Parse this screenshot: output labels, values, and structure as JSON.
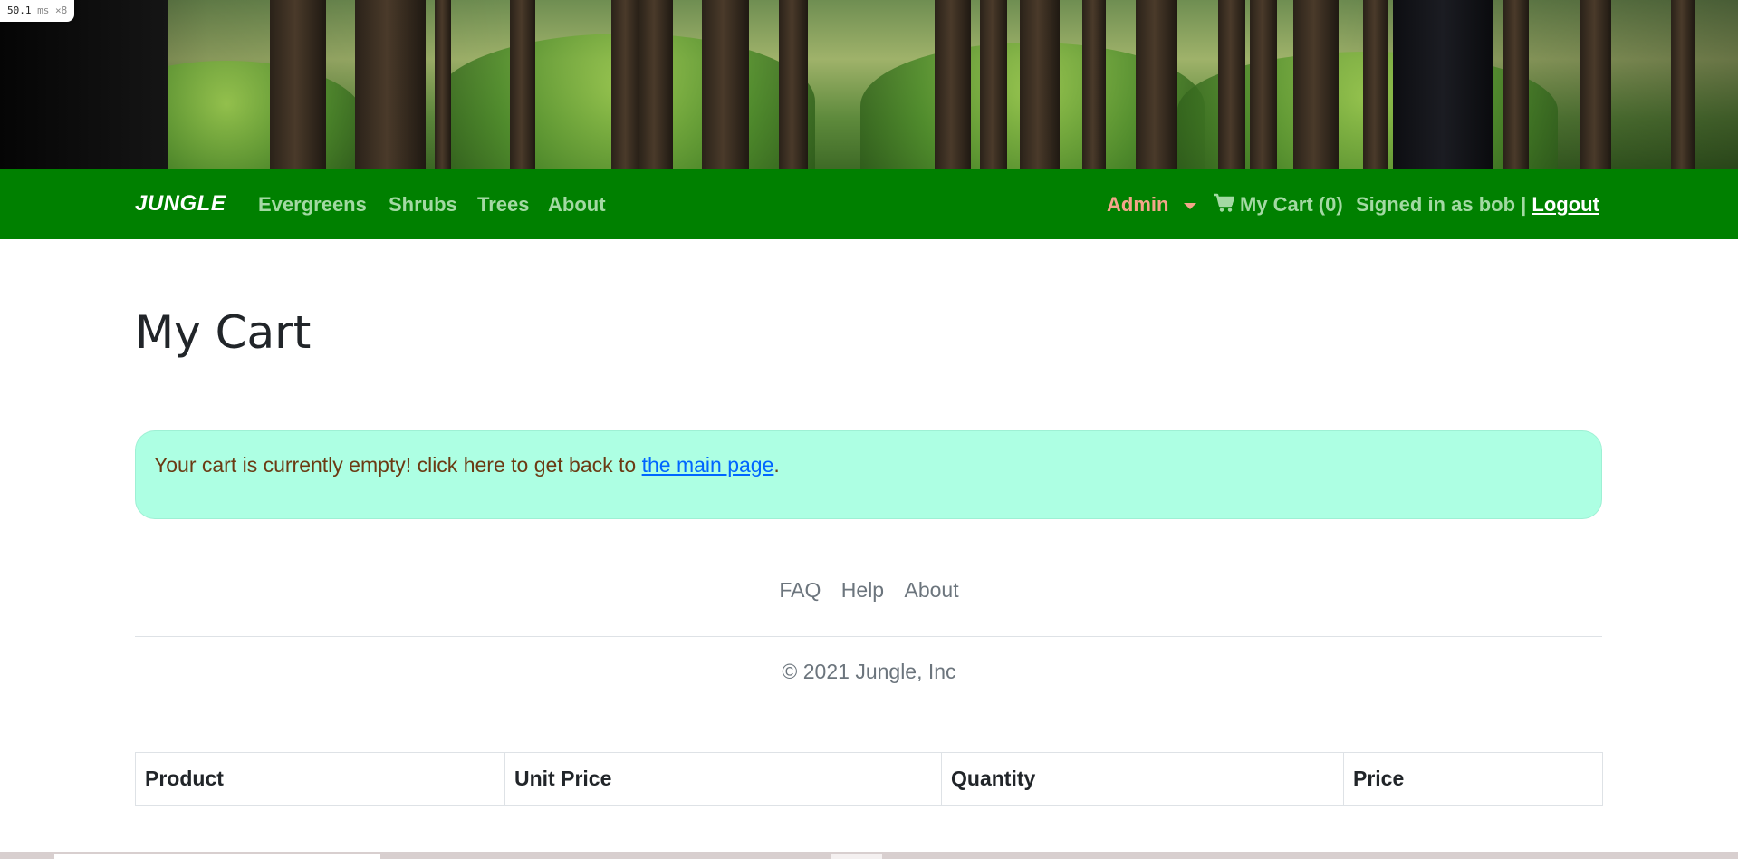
{
  "perf_badge": {
    "value": "50.1",
    "unit": "ms ×8"
  },
  "navbar": {
    "brand": "JUNGLE",
    "links": [
      "Evergreens",
      "Shrubs",
      "Trees",
      "About"
    ],
    "admin_label": "Admin",
    "cart_label": "My Cart (0)",
    "signed_in_text": "Signed in as bob |",
    "logout_label": "Logout",
    "colors": {
      "background": "#008000",
      "link": "#a3d9a3",
      "admin": "#f4a58a"
    }
  },
  "main": {
    "title": "My Cart",
    "alert": {
      "text_before": "Your cart is currently empty! click here to get back to",
      "link_text": "the main page",
      "text_after": "."
    }
  },
  "footer": {
    "links": [
      "FAQ",
      "Help",
      "About"
    ],
    "copyright": "© 2021 Jungle, Inc"
  },
  "table": {
    "columns": [
      "Product",
      "Unit Price",
      "Quantity",
      "Price"
    ]
  }
}
